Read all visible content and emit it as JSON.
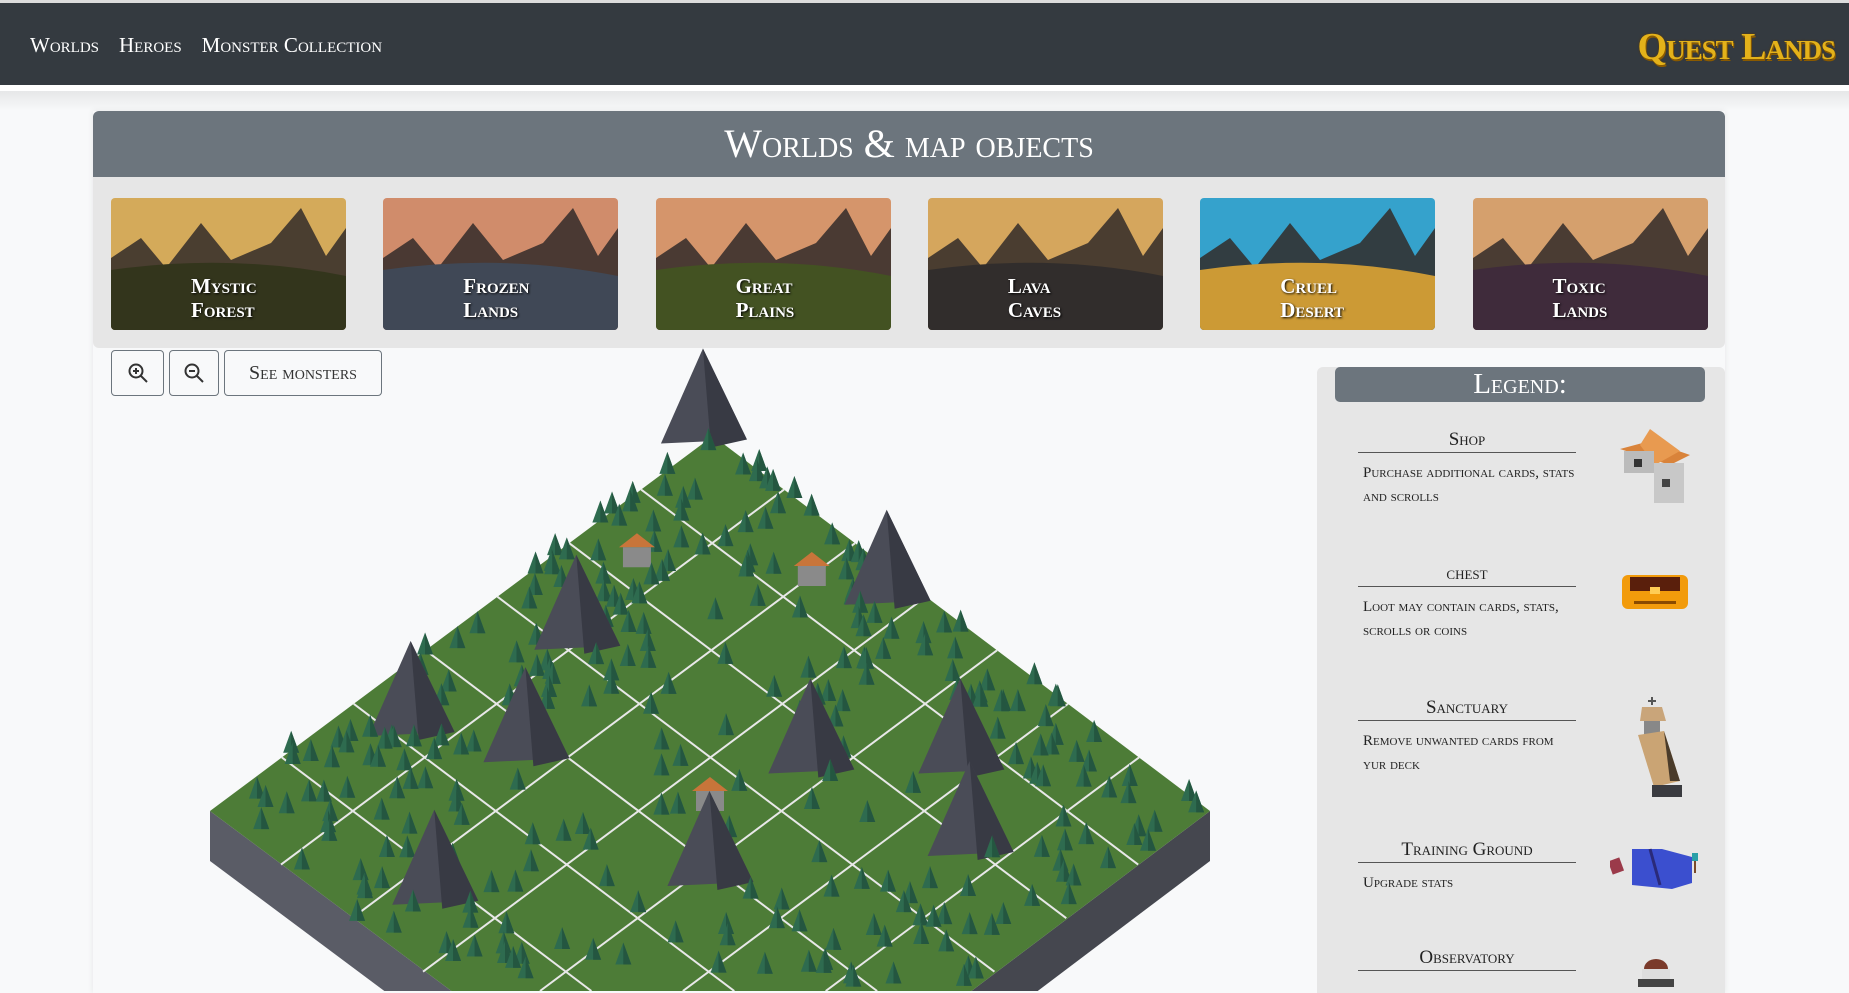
{
  "nav": {
    "links": [
      "Worlds",
      "Heroes",
      "Monster Collection"
    ],
    "logo": "Quest Lands"
  },
  "page_title": "Worlds & map objects",
  "worlds": [
    {
      "name_1": "Mystic",
      "name_2": "Forest",
      "sky": "#f9c86a",
      "ground": "#3d3f22"
    },
    {
      "name_1": "Frozen",
      "name_2": "Lands",
      "sky": "#f5a57e",
      "ground": "#4c5566"
    },
    {
      "name_1": "Great",
      "name_2": "Plains",
      "sky": "#fbb07e",
      "ground": "#4f6128"
    },
    {
      "name_1": "Lava",
      "name_2": "Caves",
      "sky": "#fbc46e",
      "ground": "#3a3634"
    },
    {
      "name_1": "Cruel",
      "name_2": "Desert",
      "sky": "#3fbff0",
      "ground": "#f0b53f"
    },
    {
      "name_1": "Toxic",
      "name_2": "Lands",
      "sky": "#fbbd80",
      "ground": "#4a3346"
    }
  ],
  "toolbar": {
    "zoom_in": "zoom-in",
    "zoom_out": "zoom-out",
    "see_monsters": "See monsters"
  },
  "legend": {
    "title": "Legend:",
    "items": [
      {
        "title": "Shop",
        "desc": "Purchase additional cards, stats and scrolls"
      },
      {
        "title": "chest",
        "desc": "Loot may contain cards, stats, scrolls or coins"
      },
      {
        "title": "Sanctuary",
        "desc": "Remove unwanted cards from yur deck"
      },
      {
        "title": "Training Ground",
        "desc": "Upgrade stats"
      },
      {
        "title": "Observatory",
        "desc": ""
      }
    ]
  },
  "colors": {
    "navbar": "#343a40",
    "panel": "#6c757d",
    "grass": "#4d7c37",
    "tree": "#2e6b4f",
    "mountain": "#4a4c57"
  }
}
